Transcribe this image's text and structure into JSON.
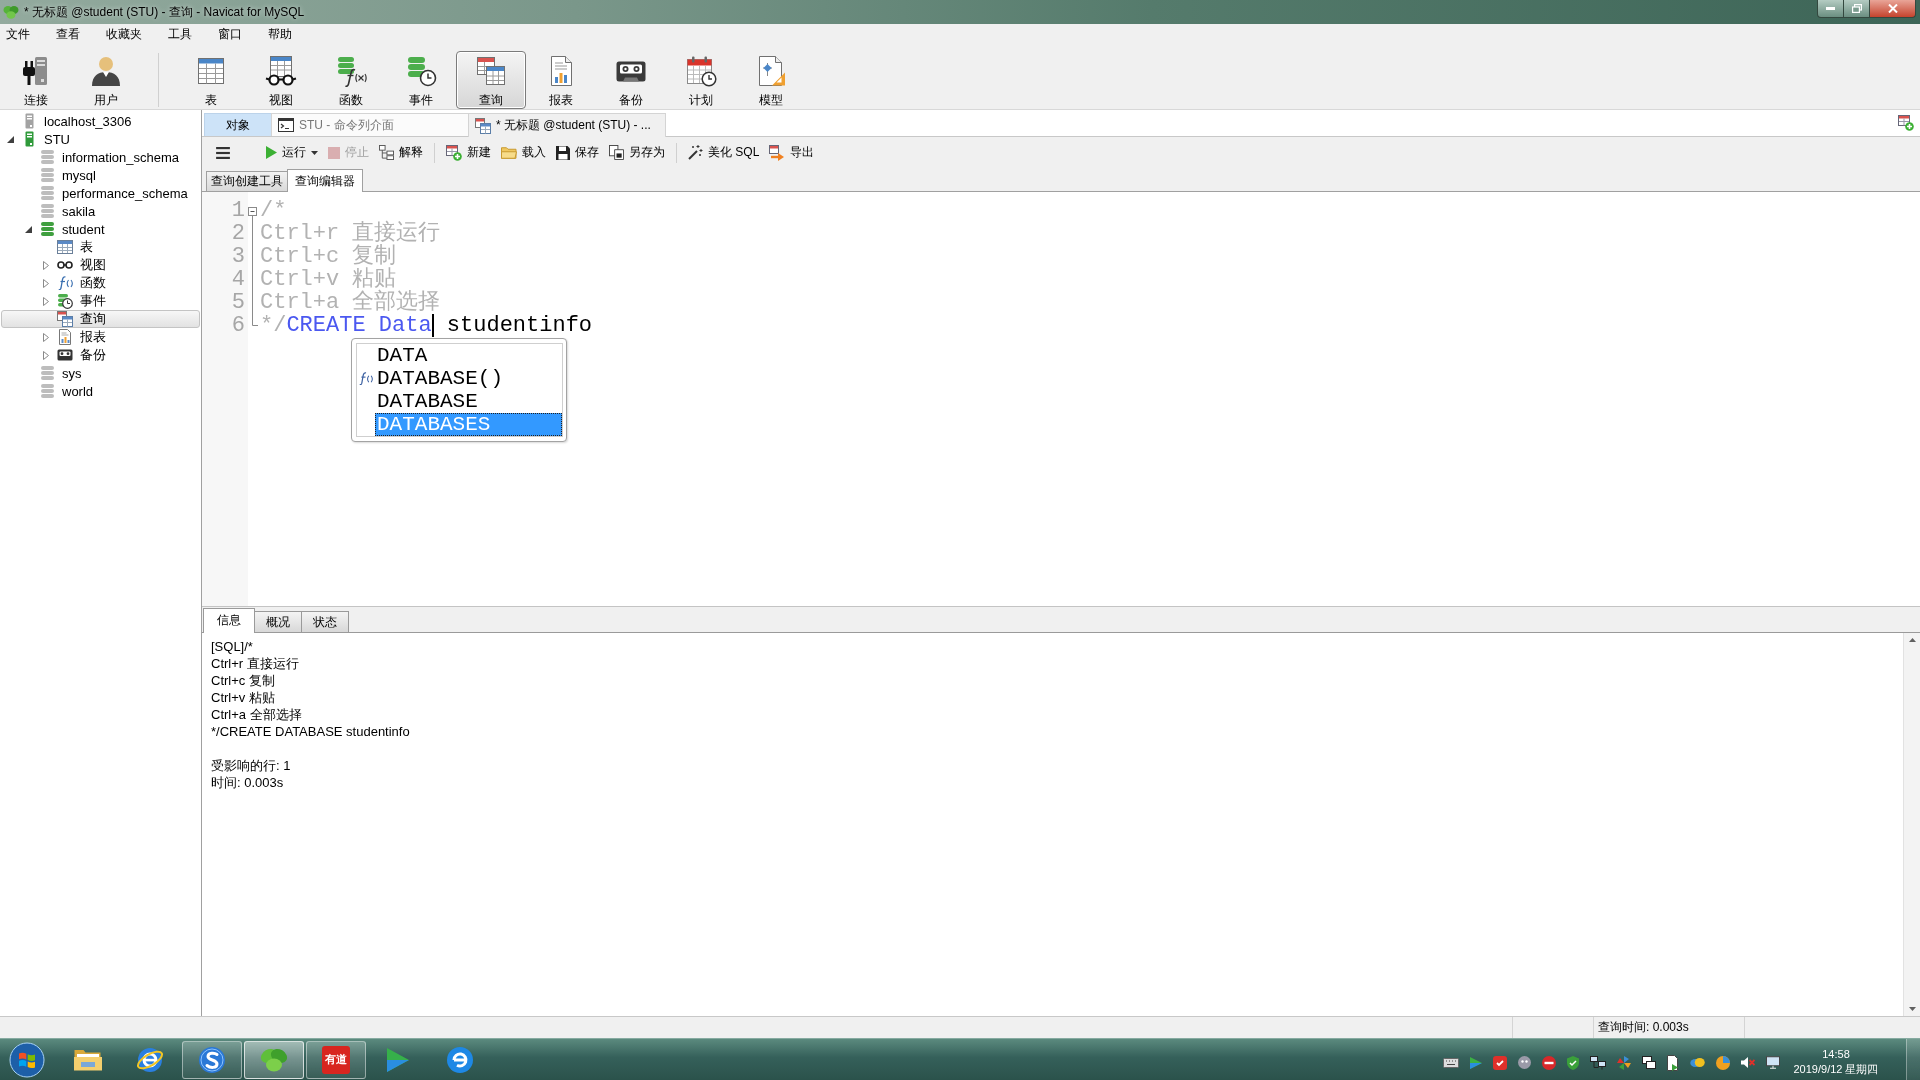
{
  "window": {
    "title": "* 无标题 @student (STU) - 查询 - Navicat for MySQL"
  },
  "menu": [
    "文件",
    "查看",
    "收藏夹",
    "工具",
    "窗口",
    "帮助"
  ],
  "toolbar": {
    "groups": [
      [
        {
          "kind": "connect",
          "label": "连接",
          "selected": false
        },
        {
          "kind": "user",
          "label": "用户",
          "selected": false
        }
      ],
      [
        {
          "kind": "table",
          "label": "表",
          "selected": false
        },
        {
          "kind": "view",
          "label": "视图",
          "selected": false
        },
        {
          "kind": "function",
          "label": "函数",
          "selected": false
        },
        {
          "kind": "event",
          "label": "事件",
          "selected": false
        },
        {
          "kind": "query",
          "label": "查询",
          "selected": true
        },
        {
          "kind": "report",
          "label": "报表",
          "selected": false
        },
        {
          "kind": "backup",
          "label": "备份",
          "selected": false
        },
        {
          "kind": "schedule",
          "label": "计划",
          "selected": false
        },
        {
          "kind": "model",
          "label": "模型",
          "selected": false
        }
      ]
    ]
  },
  "navigator": {
    "tree": [
      {
        "kind": "connection",
        "label": "localhost_3306",
        "open": false,
        "selected": false
      },
      {
        "kind": "connection",
        "label": "STU",
        "open": true,
        "expanded": true,
        "selected": false,
        "children": [
          {
            "kind": "database",
            "label": "information_schema",
            "open": false,
            "selected": false
          },
          {
            "kind": "database",
            "label": "mysql",
            "open": false,
            "selected": false
          },
          {
            "kind": "database",
            "label": "performance_schema",
            "open": false,
            "selected": false
          },
          {
            "kind": "database",
            "label": "sakila",
            "open": false,
            "selected": false
          },
          {
            "kind": "database",
            "label": "student",
            "open": true,
            "expanded": true,
            "selected": false,
            "children": [
              {
                "kind": "tables",
                "label": "表",
                "selected": false
              },
              {
                "kind": "views",
                "label": "视图",
                "expanded": false,
                "selected": false
              },
              {
                "kind": "functions",
                "label": "函数",
                "expanded": false,
                "selected": false
              },
              {
                "kind": "events",
                "label": "事件",
                "expanded": false,
                "selected": false
              },
              {
                "kind": "queries",
                "label": "查询",
                "selected": true
              },
              {
                "kind": "reports",
                "label": "报表",
                "expanded": false,
                "selected": false
              },
              {
                "kind": "backups",
                "label": "备份",
                "expanded": false,
                "selected": false
              }
            ]
          },
          {
            "kind": "database",
            "label": "sys",
            "open": false,
            "selected": false
          },
          {
            "kind": "database",
            "label": "world",
            "open": false,
            "selected": false
          }
        ]
      }
    ]
  },
  "tabs": [
    {
      "kind": "objects",
      "label": "对象",
      "selected": false
    },
    {
      "kind": "console",
      "label": "STU - 命令列介面",
      "selected": false
    },
    {
      "kind": "query",
      "label": "* 无标题 @student (STU) - ...",
      "selected": true
    }
  ],
  "query_toolbar": {
    "groups": [
      [
        {
          "kind": "menu"
        }
      ],
      [
        {
          "kind": "run",
          "label": "运行",
          "dropdown": true,
          "disabled": false
        },
        {
          "kind": "stop",
          "label": "停止",
          "disabled": true
        },
        {
          "kind": "explain",
          "label": "解释",
          "disabled": false
        }
      ],
      [
        {
          "kind": "new",
          "label": "新建",
          "disabled": false
        },
        {
          "kind": "load",
          "label": "载入",
          "disabled": false
        },
        {
          "kind": "save",
          "label": "保存",
          "disabled": false
        },
        {
          "kind": "save_as",
          "label": "另存为",
          "disabled": false
        }
      ],
      [
        {
          "kind": "beautify",
          "label": "美化 SQL",
          "disabled": false
        },
        {
          "kind": "export",
          "label": "导出",
          "disabled": false
        }
      ]
    ]
  },
  "editor_tabs": [
    {
      "label": "查询创建工具",
      "selected": false
    },
    {
      "label": "查询编辑器",
      "selected": true
    }
  ],
  "editor": {
    "lines": [
      {
        "number": "1",
        "kind": "fold_start",
        "tokens": [
          {
            "kind": "comment",
            "text": "/*"
          }
        ]
      },
      {
        "number": "2",
        "kind": "fold_inside",
        "tokens": [
          {
            "kind": "comment",
            "text": "Ctrl+r 直接运行"
          }
        ]
      },
      {
        "number": "3",
        "kind": "fold_inside",
        "tokens": [
          {
            "kind": "comment",
            "text": "Ctrl+c 复制"
          }
        ]
      },
      {
        "number": "4",
        "kind": "fold_inside",
        "tokens": [
          {
            "kind": "comment",
            "text": "Ctrl+v 粘贴"
          }
        ]
      },
      {
        "number": "5",
        "kind": "fold_inside",
        "tokens": [
          {
            "kind": "comment",
            "text": "Ctrl+a 全部选择"
          }
        ]
      },
      {
        "number": "6",
        "kind": "fold_end",
        "tokens": [
          {
            "kind": "comment",
            "text": "*/"
          },
          {
            "kind": "keyword",
            "text": "CREATE Data"
          },
          {
            "kind": "cursor"
          },
          {
            "kind": "plain",
            "text": " studentinfo"
          }
        ]
      }
    ],
    "autocomplete": [
      {
        "kind": "keyword",
        "label": "DATA",
        "selected": false
      },
      {
        "kind": "function",
        "label": "DATABASE()",
        "selected": false
      },
      {
        "kind": "keyword",
        "label": "DATABASE",
        "selected": false
      },
      {
        "kind": "keyword",
        "label": "DATABASES",
        "selected": true
      }
    ]
  },
  "result_tabs": [
    {
      "label": "信息",
      "selected": true
    },
    {
      "label": "概况",
      "selected": false
    },
    {
      "label": "状态",
      "selected": false
    }
  ],
  "message": {
    "blocks": [
      [
        "[SQL]/*",
        "Ctrl+r 直接运行",
        "Ctrl+c 复制",
        "Ctrl+v 粘贴",
        "Ctrl+a 全部选择",
        "*/CREATE DATABASE studentinfo"
      ],
      [
        "受影响的行: 1",
        "时间: 0.003s"
      ]
    ]
  },
  "status_bar": {
    "query_time": "查询时间: 0.003s"
  },
  "taskbar": {
    "apps": [
      {
        "kind": "folder",
        "running": false,
        "selected": false
      },
      {
        "kind": "e_ring",
        "running": false,
        "selected": false
      },
      {
        "kind": "s_logo",
        "running": true,
        "selected": false
      },
      {
        "kind": "leaf",
        "running": true,
        "selected": true
      },
      {
        "kind": "text_tile",
        "text": "有道",
        "running": true,
        "selected": false
      },
      {
        "kind": "play",
        "running": false,
        "selected": false
      },
      {
        "kind": "e_swirl",
        "running": false,
        "selected": false
      }
    ],
    "tray": [
      {
        "kind": "keyboard"
      },
      {
        "kind": "play"
      },
      {
        "kind": "badge"
      },
      {
        "kind": "face"
      },
      {
        "kind": "block"
      },
      {
        "kind": "shield"
      },
      {
        "kind": "network"
      },
      {
        "kind": "pinwheel"
      },
      {
        "kind": "windows"
      },
      {
        "kind": "document"
      },
      {
        "kind": "cloud"
      },
      {
        "kind": "pie"
      },
      {
        "kind": "speaker_off"
      },
      {
        "kind": "monitor"
      }
    ],
    "time": "14:58",
    "date": "2019/9/12 星期四"
  }
}
